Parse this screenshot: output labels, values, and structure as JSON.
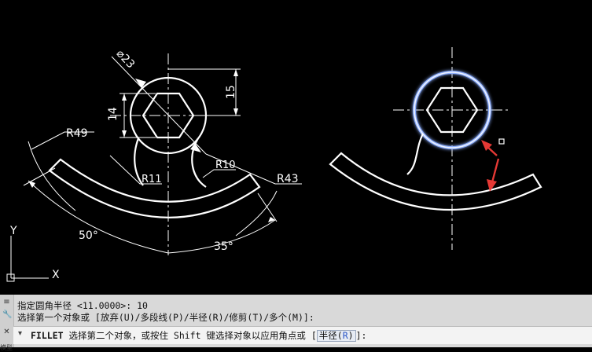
{
  "drawing": {
    "left_figure": {
      "dims": {
        "diameter": "⌀23",
        "height_14": "14",
        "height_15": "15",
        "r49": "R49",
        "r11": "R11",
        "r10": "R10",
        "r43": "R43",
        "angle_50": "50°",
        "angle_35": "35°"
      }
    },
    "ucs": {
      "y_label": "Y",
      "x_label": "X"
    }
  },
  "command_line": {
    "history": [
      "指定圆角半径 <11.0000>: 10",
      "选择第一个对象或 [放弃(U)/多段线(P)/半径(R)/修剪(T)/多个(M)]:"
    ],
    "prompt": {
      "command": "FILLET",
      "text": " 选择第二个对象，或按住 Shift 键选择对象以应用角点或 [",
      "option_label": "半径(",
      "option_key": "R",
      "option_close": ")",
      "suffix": "]:"
    },
    "tab_label": "模型"
  },
  "colors": {
    "background": "#000000",
    "geometry": "#ffffff",
    "selection_glow": "#8fb0ff",
    "arrow": "#e53935"
  }
}
